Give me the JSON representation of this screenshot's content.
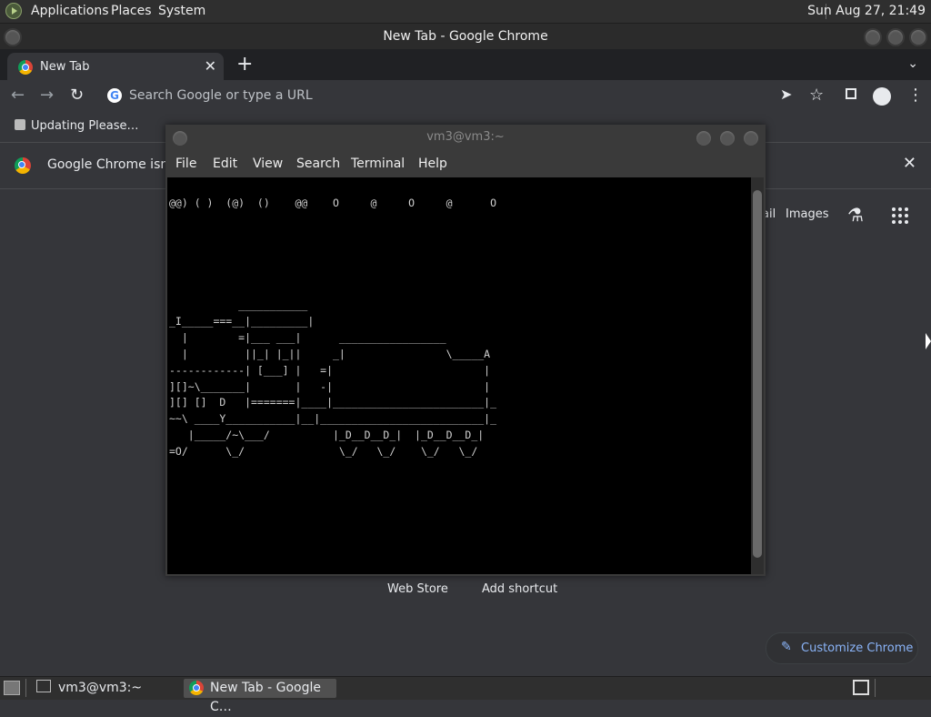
{
  "top_panel": {
    "menus": [
      "Applications",
      "Places",
      "System"
    ],
    "clock": "Sun Aug 27, 21:49"
  },
  "chrome": {
    "window_title": "New Tab - Google Chrome",
    "tab_title": "New Tab",
    "tab_close": "✕",
    "new_tab": "+",
    "omnibox_placeholder": "Search Google or type a URL",
    "bookmark_item": "Updating Please…",
    "infobar_text": "Google Chrome isn't y",
    "infobar_close": "✕",
    "ntp": {
      "link_gmail": "ail",
      "link_images": "Images",
      "shortcut_webstore": "Web Store",
      "shortcut_add": "Add shortcut",
      "customize_label": "Customize Chrome"
    }
  },
  "terminal": {
    "title": "vm3@vm3:~",
    "menu": [
      "File",
      "Edit",
      "View",
      "Search",
      "Terminal",
      "Help"
    ],
    "smoke_line": "@@) ( )  (@)  ()    @@    O     @     O     @      O",
    "train_lines": [
      "           ___________",
      "_I_____===__|_________|",
      "  |        =|___ ___|      _________________",
      "  |         ||_| |_||     _|                \\_____A",
      "------------| [___] |   =|                        |",
      "][]~\\_______|       |   -|                        |",
      "][] []  D   |=======|____|________________________|_",
      "~~\\ ____Y___________|__|__________________________|_",
      "   |_____/~\\___/          |_D__D__D_|  |_D__D__D_|",
      "=O/      \\_/               \\_/   \\_/    \\_/   \\_/"
    ]
  },
  "bottom_panel": {
    "tasks": [
      "vm3@vm3:~",
      "New Tab - Google C…"
    ]
  },
  "colors": {
    "panel": "#2f2f2f",
    "chrome_bg": "#35363a",
    "terminal_bg": "#000000",
    "accent_link": "#8ab4f8"
  }
}
